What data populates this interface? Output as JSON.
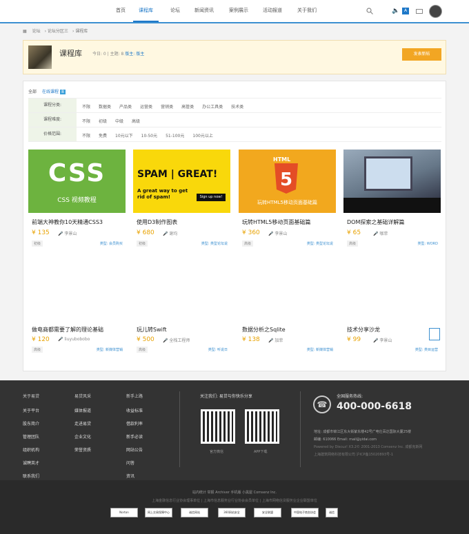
{
  "nav": {
    "items": [
      "首页",
      "课程库",
      "论坛",
      "新闻资讯",
      "案例展示",
      "活动报道",
      "关于我们"
    ],
    "badge": "A"
  },
  "breadcrumb": [
    "论坛",
    "论坛分区三",
    "课程库"
  ],
  "header": {
    "title": "课程库",
    "today": "今日: 0",
    "topics": "主题: 8",
    "moderator": "版主: 版主",
    "post_button": "发表新帖"
  },
  "tabs": {
    "all": "全部",
    "online": "在线课程",
    "mini": "8"
  },
  "filters": [
    {
      "label": "课程分类:",
      "options": [
        "不限",
        "数据类",
        "产品类",
        "运营类",
        "营销类",
        "高管类",
        "办公工具类",
        "技术类"
      ]
    },
    {
      "label": "课程难度:",
      "options": [
        "不限",
        "初级",
        "中级",
        "高级"
      ]
    },
    {
      "label": "价格范围:",
      "options": [
        "不限",
        "免费",
        "10元以下",
        "10-50元",
        "51-100元",
        "100元以上"
      ]
    }
  ],
  "courses": [
    {
      "title": "前端大神教你10天精通CSS3",
      "price": "¥ 135",
      "author": "李景山",
      "level": "初级",
      "type": "类型: 会员购买",
      "img_text": "CSS",
      "img_sub": "CSS 视频教程",
      "color": "#6db33f"
    },
    {
      "title": "使用D3制作图表",
      "price": "¥ 680",
      "author": "谢均",
      "level": "初级",
      "type": "类型: 类型论坛说",
      "img_text": "SPAM | GREAT!",
      "img_sub": "A great way to get rid of spam!",
      "img_btn": "Sign up now!",
      "color": "#f9d80b"
    },
    {
      "title": "玩转HTML5移动页面基础篇",
      "price": "¥ 360",
      "author": "李景山",
      "level": "高级",
      "type": "类型: 类型论坛说",
      "img_text": "HTML",
      "img_sub": "玩转HTML5移动页面基础篇",
      "color": "#f2a81e"
    },
    {
      "title": "DOM探索之基础详解篇",
      "price": "¥ 65",
      "author": "咖菲",
      "level": "高级",
      "type": "类型: WORD",
      "img_text": "",
      "color": "#8899a6"
    }
  ],
  "courses2": [
    {
      "title": "做电商都需要了解的理论基础",
      "price": "¥ 120",
      "author": "liuyubobobo",
      "level": "高级",
      "type": "类型: 新媒体营销"
    },
    {
      "title": "玩儿转Swift",
      "price": "¥ 500",
      "author": "全栈工程师",
      "level": "高级",
      "type": "类型: 听说日"
    },
    {
      "title": "数据分析之Sqlite",
      "price": "¥ 138",
      "author": "加菲",
      "level": "",
      "type": "类型: 新媒体营销"
    },
    {
      "title": "技术分享沙龙",
      "price": "¥ 99",
      "author": "李景山",
      "level": "",
      "type": "类型: 类目运营"
    }
  ],
  "footer": {
    "cols": [
      {
        "head": "关于易贷",
        "items": [
          "关于平台",
          "股东简介",
          "管理团队",
          "组织机构",
          "诚聘英才",
          "联系我们"
        ]
      },
      {
        "head": "易贷风采",
        "items": [
          "媒体报道",
          "走进易贷",
          "企业文化",
          "荣誉资质"
        ]
      },
      {
        "head": "新手上路",
        "items": [
          "收益标准",
          "借款利率",
          "新手必读",
          "网站公告",
          "问答",
          "资讯"
        ]
      }
    ],
    "follow": "关注我们: 易贷与你快乐分享",
    "qr_labels": [
      "官方微信",
      "APP下载"
    ],
    "hotline_label": "全国服务热线:",
    "hotline": "400-000-6618",
    "address": "地址: 成都市锦江区东大街紫东楼42号广电仕百达国际大厦25楼",
    "email": "邮编: 610066 Email: mail@yidai.com",
    "powered": "Powered by Discuz! X3.2© 2001-2013 Comsenz Inc. 成都克斯网",
    "icp": "上海建筑网络科技有限公司 沪ICP备15020893号-1",
    "links": "站内统计   举报   Archiver   手机版   小黑屋   Comsenz Inc.",
    "assoc": "上海金融信息行业协会理事单位 | 上海市信息服务业行业协会会员单位 | 上海市网络信贷服务业企业联盟单位",
    "badges": [
      "Norton",
      "网上交易保障中心",
      "诚信网站",
      "360网站安全",
      "安全联盟",
      "中国电子商务协会",
      "诚信"
    ]
  }
}
